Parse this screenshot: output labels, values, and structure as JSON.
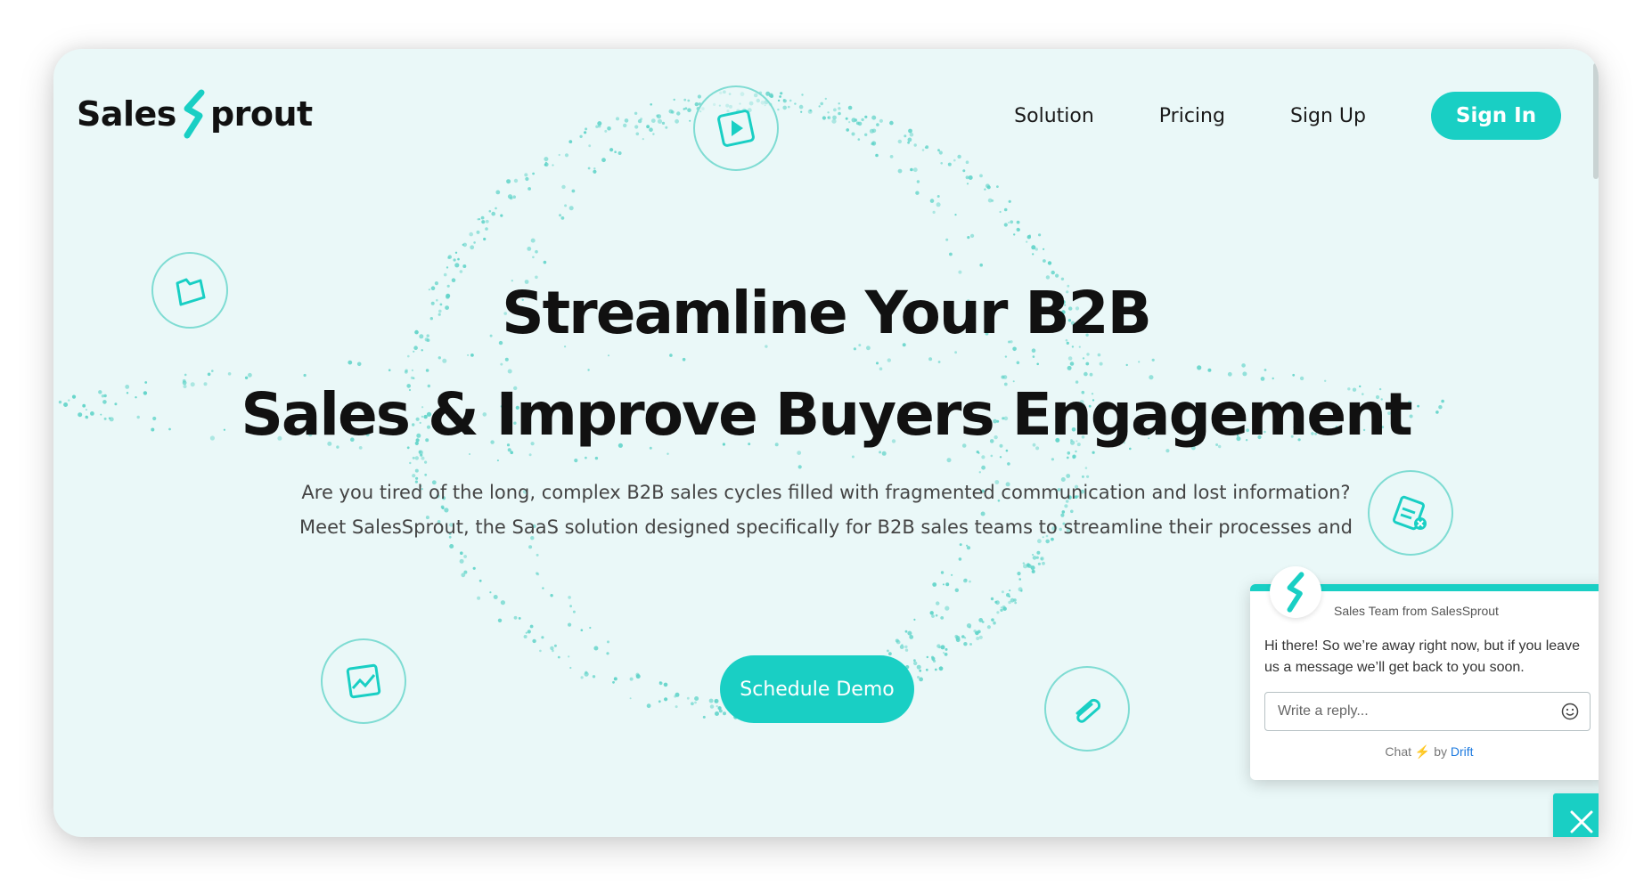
{
  "brand": {
    "name_part1": "Sales",
    "name_part2": "prout",
    "accent_color": "#19cfc4"
  },
  "nav": {
    "links": [
      "Solution",
      "Pricing",
      "Sign Up"
    ],
    "signin_label": "Sign In"
  },
  "hero": {
    "title_line1": "Streamline Your B2B",
    "title_line2": "Sales & Improve Buyers Engagement",
    "sub_line1": "Are you tired of the long, complex B2B sales cycles filled with fragmented communication and lost information?",
    "sub_line2": "Meet SalesSprout, the SaaS solution designed specifically for B2B sales teams to streamline their processes and",
    "cta_label": "Schedule Demo"
  },
  "floating_icons": [
    "play-icon",
    "folder-icon",
    "document-icon",
    "chart-icon",
    "paperclip-icon"
  ],
  "chat": {
    "team_name": "Sales Team from SalesSprout",
    "message": "Hi there! So we’re away right now, but if you leave us a message we’ll get back to you soon.",
    "input_placeholder": "Write a reply...",
    "footer_prefix": "Chat",
    "footer_by": "by",
    "footer_brand": "Drift"
  }
}
